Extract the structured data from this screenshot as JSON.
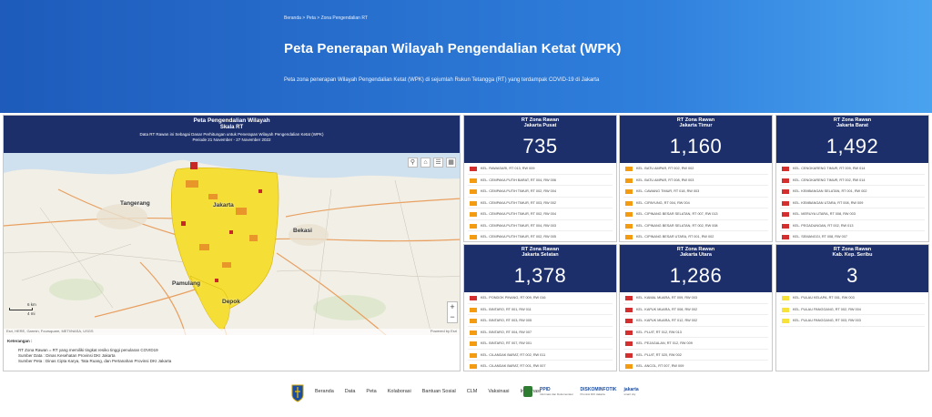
{
  "breadcrumb": "Beranda > Peta > Zona Pengendalian RT",
  "page_title": "Peta Penerapan Wilayah Pengendalian Ketat (WPK)",
  "page_subtitle": "Peta zona penerapan Wilayah Pengendalian Ketat (WPK) di sejumlah Rukun Tetangga (RT) yang terdampak COVID-19 di Jakarta",
  "map": {
    "title": "Peta Pengendalian Wilayah",
    "subtitle": "Skala RT",
    "desc": "Data RT Rawan ini Sebagai Dasar Perhitungan untuk Penerapan Wilayah Pengendalian Ketat (WPK)",
    "period": "Periode 21 November - 27 November 2022",
    "labels": {
      "tangerang": "Tangerang",
      "jakarta": "Jakarta",
      "bekasi": "Bekasi",
      "pamulang": "Pamulang",
      "depok": "Depok"
    },
    "scale_km": "6 km",
    "scale_mi": "4 mi",
    "attribution": "Esri, HERE, Garmin, Foursquare, METI/NASA, USGS",
    "powered_by": "Powered by Esri",
    "zoom_in": "+",
    "zoom_out": "−"
  },
  "legend": {
    "heading": "Keterangan :",
    "items": [
      "RT Zona Rawan = RT yang memiliki tingkat resiko tinggi penularan COVID19",
      "Sumber Data : Dinas Kesehatan Provinsi DKI Jakarta",
      "Sumber Peta : Dinas Cipta Karya, Tata Ruang, dan Pertanahan Provinsi DKI Jakarta"
    ]
  },
  "cards": [
    {
      "title": "RT Zona Rawan",
      "region": "Jakarta Pusat",
      "count": "735",
      "rows": [
        {
          "text": "KEL. RAWASARI, RT 013, RW 009",
          "color": "red"
        },
        {
          "text": "KEL. CEMPAKA PUTIH BARAT, RT 004, RW 006",
          "color": "orange"
        },
        {
          "text": "KEL. CEMPAKA PUTIH TIMUR, RT 002, RW 004",
          "color": "orange"
        },
        {
          "text": "KEL. CEMPAKA PUTIH TIMUR, RT 003, RW 002",
          "color": "orange"
        },
        {
          "text": "KEL. CEMPAKA PUTIH TIMUR, RT 002, RW 004",
          "color": "orange"
        },
        {
          "text": "KEL. CEMPAKA PUTIH TIMUR, RT 004, RW 003",
          "color": "orange"
        },
        {
          "text": "KEL. CEMPAKA PUTIH TIMUR, RT 002, RW 005",
          "color": "orange"
        }
      ]
    },
    {
      "title": "RT Zona Rawan",
      "region": "Jakarta Timur",
      "count": "1,160",
      "rows": [
        {
          "text": "KEL. BATU AMPAR, RT 002, RW 002",
          "color": "orange"
        },
        {
          "text": "KEL. BATU AMPAR, RT 008, RW 003",
          "color": "orange"
        },
        {
          "text": "KEL. CAWANG TIMUR, RT 018, RW 003",
          "color": "orange"
        },
        {
          "text": "KEL. CIPAYUNG, RT 004, RW 004",
          "color": "orange"
        },
        {
          "text": "KEL. CIPINANG BESAR SELATAN, RT 007, RW 013",
          "color": "orange"
        },
        {
          "text": "KEL. CIPINANG BESAR SELATAN, RT 002, RW 008",
          "color": "orange"
        },
        {
          "text": "KEL. CIPINANG BESAR UTARA, RT 001, RW 002",
          "color": "orange"
        }
      ]
    },
    {
      "title": "RT Zona Rawan",
      "region": "Jakarta Barat",
      "count": "1,492",
      "rows": [
        {
          "text": "KEL. CENGKARENG TIMUR, RT 009, RW 014",
          "color": "red"
        },
        {
          "text": "KEL. CENGKARENG TIMUR, RT 002, RW 014",
          "color": "red"
        },
        {
          "text": "KEL. KEMBANGAN SELATAN, RT 001, RW 002",
          "color": "red"
        },
        {
          "text": "KEL. KEMBANGAN UTARA, RT 008, RW 009",
          "color": "red"
        },
        {
          "text": "KEL. MERUYA UTARA, RT 008, RW 003",
          "color": "red"
        },
        {
          "text": "KEL. PEGADUNGAN, RT 002, RW 013",
          "color": "red"
        },
        {
          "text": "KEL. SEMANGGI, RT 008, RW 007",
          "color": "red"
        }
      ]
    },
    {
      "title": "RT Zona Rawan",
      "region": "Jakarta Selatan",
      "count": "1,378",
      "rows": [
        {
          "text": "KEL. PONDOK PINANG, RT 009, RW 016",
          "color": "red"
        },
        {
          "text": "KEL. BINTARO, RT 001, RW 011",
          "color": "orange"
        },
        {
          "text": "KEL. BINTARO, RT 003, RW 005",
          "color": "orange"
        },
        {
          "text": "KEL. BINTARO, RT 004, RW 007",
          "color": "orange"
        },
        {
          "text": "KEL. BINTARO, RT 007, RW 001",
          "color": "orange"
        },
        {
          "text": "KEL. CILANDAK BARAT, RT 002, RW 011",
          "color": "orange"
        },
        {
          "text": "KEL. CILANDAK BARAT, RT 001, RW 007",
          "color": "orange"
        },
        {
          "text": "KEL. CILANDAK BARAT, RT 003, RW 002",
          "color": "orange"
        }
      ]
    },
    {
      "title": "RT Zona Rawan",
      "region": "Jakarta Utara",
      "count": "1,286",
      "rows": [
        {
          "text": "KEL. KAMAL MUARA, RT 009, RW 003",
          "color": "red"
        },
        {
          "text": "KEL. KAPUK MUARA, RT 008, RW 002",
          "color": "red"
        },
        {
          "text": "KEL. KAPUK MUARA, RT 012, RW 002",
          "color": "red"
        },
        {
          "text": "KEL. PLUIT, RT 012, RW 013",
          "color": "red"
        },
        {
          "text": "KEL. PEJAGALAN, RT 012, RW 009",
          "color": "red"
        },
        {
          "text": "KEL. PLUIT, RT 020, RW 002",
          "color": "red"
        },
        {
          "text": "KEL. ANCOL, RT 007, RW 009",
          "color": "orange"
        },
        {
          "text": "KEL. ANCOL, RT 001, RW 013",
          "color": "orange"
        }
      ]
    },
    {
      "title": "RT Zona Rawan",
      "region": "Kab. Kep. Seribu",
      "count": "3",
      "rows": [
        {
          "text": "KEL. PULAU KELAPA, RT 001, RW 003",
          "color": "yellow"
        },
        {
          "text": "KEL. PULAU PANGGANG, RT 002, RW 004",
          "color": "yellow"
        },
        {
          "text": "KEL. PULAU PANGGANG, RT 003, RW 003",
          "color": "yellow"
        }
      ]
    }
  ],
  "footer": {
    "nav": [
      "Beranda",
      "Data",
      "Peta",
      "Kolaborasi",
      "Bantuan Sosial",
      "CLM",
      "Vaksinasi",
      "Informasi"
    ],
    "partners": [
      {
        "name": "PPID",
        "tag": "Informasi dan Dokumentasi"
      },
      {
        "name": "DISKOMINFOTIK",
        "tag": "Provinsi DKI Jakarta"
      },
      {
        "name": "jakarta",
        "tag": "smart city"
      }
    ]
  },
  "colors": {
    "header_navy": "#1c2f6b",
    "hero_blue": "#2f7fdc",
    "zone_red": "#d32f2f",
    "zone_orange": "#f39c12",
    "zone_yellow": "#f7e13b"
  }
}
